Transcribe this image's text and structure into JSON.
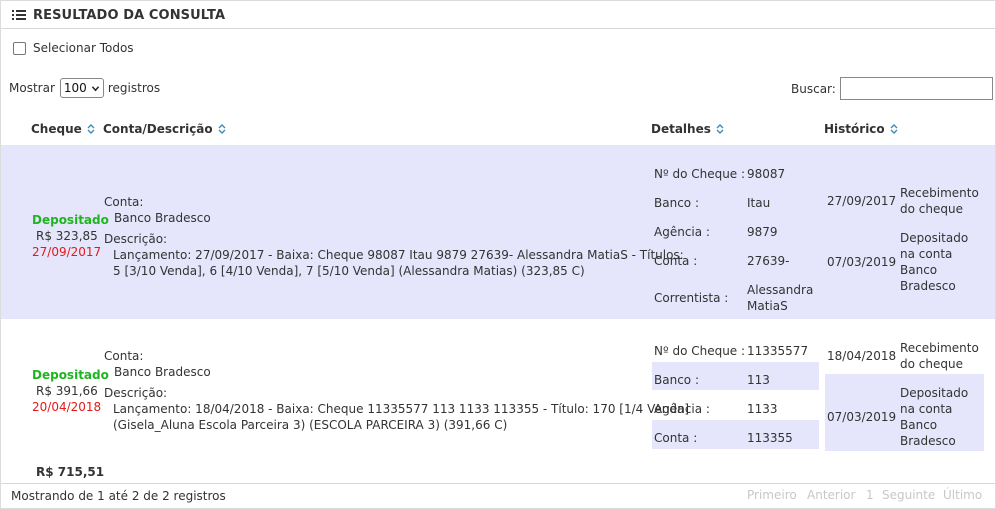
{
  "header": {
    "title": "RESULTADO DA CONSULTA"
  },
  "select_all": {
    "label": "Selecionar Todos"
  },
  "length": {
    "prefix": "Mostrar",
    "value": "100",
    "suffix": "registros"
  },
  "search": {
    "label": "Buscar:",
    "value": ""
  },
  "columns": {
    "cheque": "Cheque",
    "conta": "Conta/Descrição",
    "detalhes": "Detalhes",
    "historico": "Histórico"
  },
  "rows": [
    {
      "status": "Depositado",
      "valor": "R$ 323,85",
      "data": "27/09/2017",
      "conta_label": "Conta:",
      "conta": "Banco Bradesco",
      "descricao_label": "Descrição:",
      "descricao_l1": "Lançamento: 27/09/2017 - Baixa: Cheque 98087 Itau 9879 27639- Alessandra MatiaS - Títulos:",
      "descricao_l2": "5 [3/10 Venda], 6 [4/10 Venda], 7 [5/10 Venda] (Alessandra Matias) (323,85 C)",
      "detalhes": {
        "cheque_label": "Nº do Cheque :",
        "cheque": "98087",
        "banco_label": "Banco :",
        "banco": "Itau",
        "agencia_label": "Agência :",
        "agencia": "9879",
        "conta_label": "Conta :",
        "conta": "27639-",
        "correntista_label": "Correntista :",
        "correntista_l1": "Alessandra",
        "correntista_l2": "MatiaS"
      },
      "historico": [
        {
          "data": "27/09/2017",
          "l1": "Recebimento",
          "l2": "do cheque"
        },
        {
          "data": "07/03/2019",
          "l1": "Depositado",
          "l2": "na conta",
          "l3": "Banco",
          "l4": "Bradesco"
        }
      ]
    },
    {
      "status": "Depositado",
      "valor": "R$ 391,66",
      "data": "20/04/2018",
      "conta_label": "Conta:",
      "conta": "Banco Bradesco",
      "descricao_label": "Descrição:",
      "descricao_l1": "Lançamento: 18/04/2018 - Baixa: Cheque 11335577 113 1133 113355 - Título: 170 [1/4 Venda]",
      "descricao_l2": "(Gisela_Aluna Escola Parceira 3) (ESCOLA PARCEIRA 3) (391,66 C)",
      "detalhes": {
        "cheque_label": "Nº do Cheque :",
        "cheque": "11335577",
        "banco_label": "Banco :",
        "banco": "113",
        "agencia_label": "Agência :",
        "agencia": "1133",
        "conta_label": "Conta :",
        "conta": "113355"
      },
      "historico": [
        {
          "data": "18/04/2018",
          "l1": "Recebimento",
          "l2": "do cheque"
        },
        {
          "data": "07/03/2019",
          "l1": "Depositado",
          "l2": "na conta",
          "l3": "Banco",
          "l4": "Bradesco"
        }
      ]
    }
  ],
  "total": "R$ 715,51",
  "info": "Mostrando de 1 até 2 de 2 registros",
  "pagination": {
    "first": "Primeiro",
    "prev": "Anterior",
    "page": "1",
    "next": "Seguinte",
    "last": "Último"
  },
  "colors": {
    "row_highlight": "#e5e6fb",
    "status_green": "#1fb51f",
    "date_red": "#e21a1a",
    "sort_icon": "#3c8dbc"
  },
  "icons": {
    "header": "list-icon",
    "sort": "sort-icon",
    "select": "chevron-down-icon"
  }
}
